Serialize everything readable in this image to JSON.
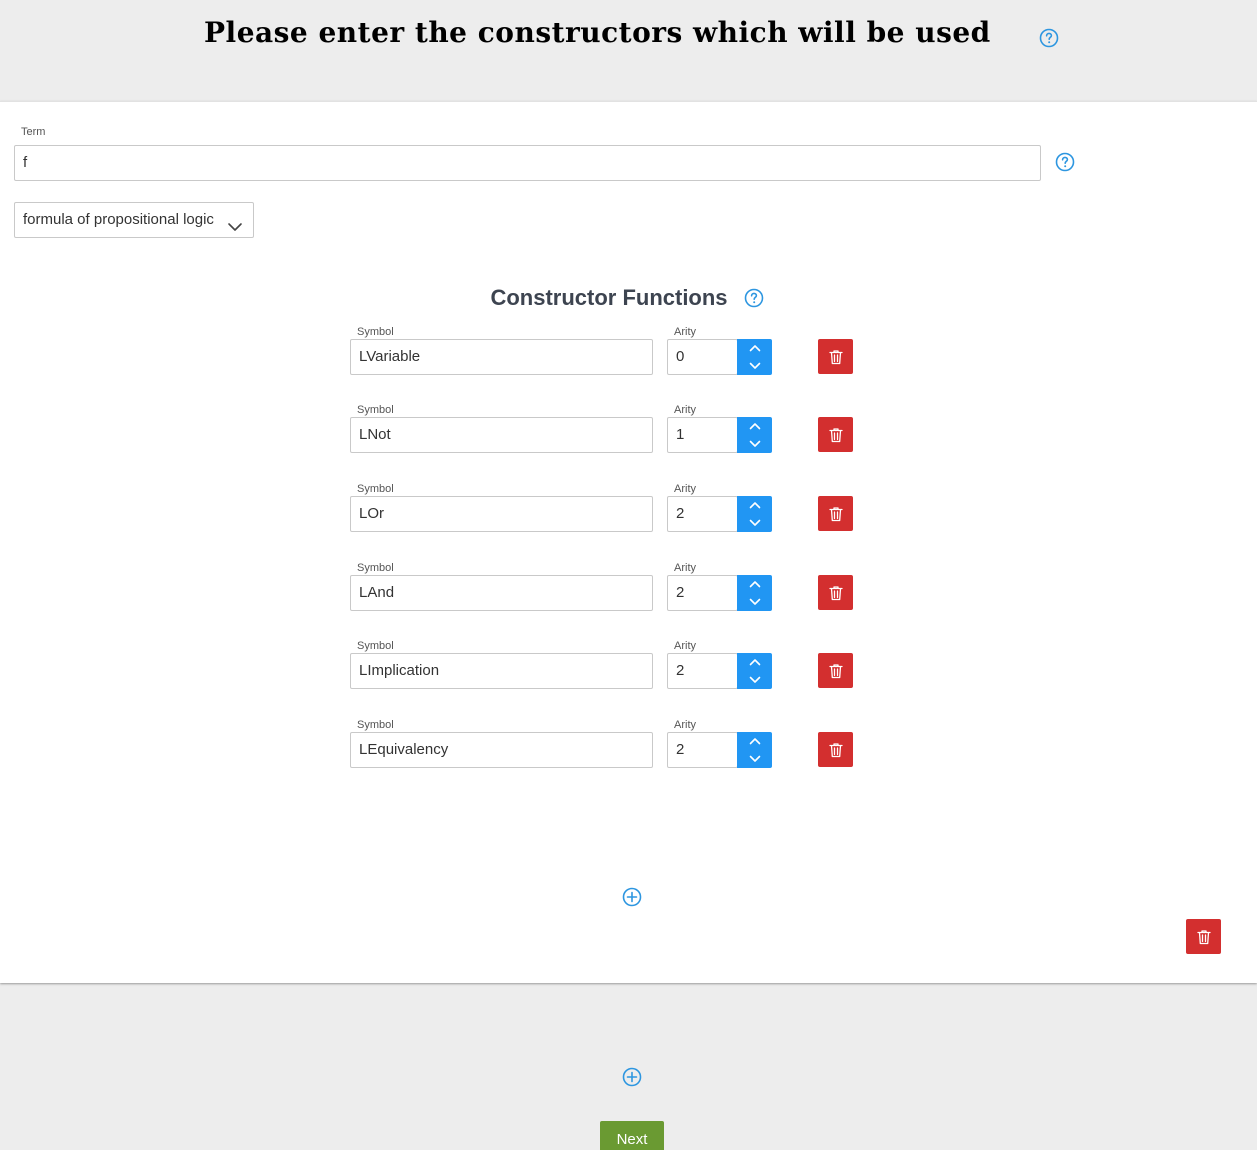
{
  "header": {
    "title": "Please enter the constructors which will be used"
  },
  "term": {
    "label": "Term",
    "value": "f"
  },
  "type_select": {
    "selected": "formula of propositional logic"
  },
  "constructors": {
    "title": "Constructor Functions",
    "symbol_label": "Symbol",
    "arity_label": "Arity",
    "rows": [
      {
        "symbol": "LVariable",
        "arity": "0"
      },
      {
        "symbol": "LNot",
        "arity": "1"
      },
      {
        "symbol": "LOr",
        "arity": "2"
      },
      {
        "symbol": "LAnd",
        "arity": "2"
      },
      {
        "symbol": "LImplication",
        "arity": "2"
      },
      {
        "symbol": "LEquivalency",
        "arity": "2"
      }
    ]
  },
  "footer": {
    "next_label": "Next"
  },
  "icons": {
    "help": "help-circle-icon",
    "add": "plus-circle-icon",
    "delete": "trash-icon",
    "stepper_up": "chevron-up-icon",
    "stepper_down": "chevron-down-icon",
    "select": "chevron-down-icon"
  },
  "colors": {
    "accent": "#2196f3",
    "danger": "#d32f2f",
    "success": "#6a9a32",
    "background": "#ededed"
  }
}
